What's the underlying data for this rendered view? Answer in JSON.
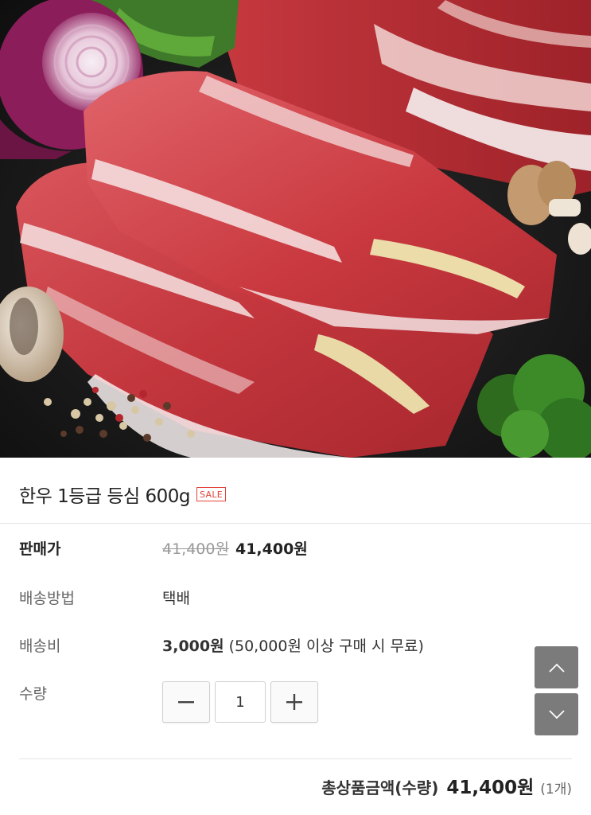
{
  "product": {
    "title": "한우 1등급 등심 600g",
    "badge": "SALE",
    "image_alt": "beef-ribeye-photo"
  },
  "info": {
    "price_label": "판매가",
    "price_original": "41,400원",
    "price_sale": "41,400원",
    "shipping_method_label": "배송방법",
    "shipping_method_value": "택배",
    "shipping_fee_label": "배송비",
    "shipping_fee_value": "3,000원",
    "shipping_fee_note": "(50,000원 이상 구매 시 무료)",
    "quantity_label": "수량",
    "quantity_value": "1"
  },
  "total": {
    "label": "총상품금액(수량)",
    "amount": "41,400원",
    "count": "(1개)"
  },
  "icons": {
    "minus": "minus-icon",
    "plus": "plus-icon",
    "up": "chevron-up-icon",
    "down": "chevron-down-icon"
  },
  "colors": {
    "sale_badge": "#e2443a",
    "scroll_button": "#7b7b7b",
    "divider": "#e4e4e4"
  }
}
